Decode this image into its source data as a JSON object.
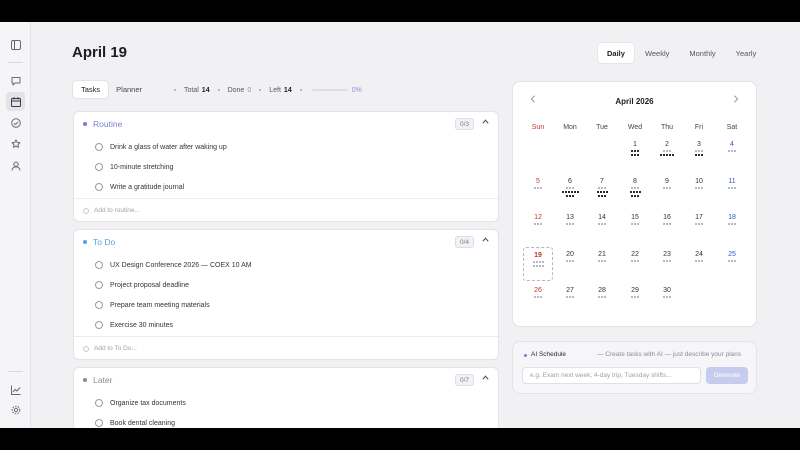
{
  "header": {
    "title": "April 19"
  },
  "view_options": [
    "Daily",
    "Weekly",
    "Monthly",
    "Yearly"
  ],
  "active_view": "Daily",
  "tabs": [
    "Tasks",
    "Planner"
  ],
  "active_tab": "Tasks",
  "stats": {
    "total_label": "Total",
    "total": "14",
    "done_label": "Done",
    "done": "0",
    "left_label": "Left",
    "left": "14",
    "progress_pct": "0%",
    "progress_fraction": 0
  },
  "sections": [
    {
      "title": "Routine",
      "count": "0/3",
      "color": "#7b7fd0",
      "tasks": [
        "Drink a glass of water after waking up",
        "10-minute stretching",
        "Write a gratitude journal"
      ],
      "add_placeholder": "Add to routine..."
    },
    {
      "title": "To Do",
      "count": "0/4",
      "color": "#5b9fdc",
      "tasks": [
        "UX Design Conference 2026 — COEX 10 AM",
        "Project proposal deadline",
        "Prepare team meeting materials",
        "Exercise 30 minutes"
      ],
      "add_placeholder": "Add to To Do..."
    },
    {
      "title": "Later",
      "count": "0/7",
      "color": "#8a8a96",
      "tasks": [
        "Organize tax documents",
        "Book dental cleaning"
      ]
    }
  ],
  "calendar": {
    "title": "April 2026",
    "prev_icon": "chevron-left-icon",
    "next_icon": "chevron-right-icon",
    "weekdays": [
      "Sun",
      "Mon",
      "Tue",
      "Wed",
      "Thu",
      "Fri",
      "Sat"
    ],
    "today": "19",
    "sunday_color": "#c0392b",
    "saturday_color": "#3a56c4",
    "weeks": [
      [
        null,
        null,
        null,
        "1",
        "2",
        "3",
        "4"
      ],
      [
        "5",
        "6",
        "7",
        "8",
        "9",
        "10",
        "11"
      ],
      [
        "12",
        "13",
        "14",
        "15",
        "16",
        "17",
        "18"
      ],
      [
        "19",
        "20",
        "21",
        "22",
        "23",
        "24",
        "25"
      ],
      [
        "26",
        "27",
        "28",
        "29",
        "30",
        null,
        null
      ]
    ]
  },
  "ai": {
    "label": "AI Schedule",
    "description": "— Create tasks with AI — just describe your plans",
    "placeholder": "e.g. Exam next week, 4-day trip, Tuesday shifts...",
    "button": "Generate"
  },
  "sidebar_icons": [
    "sidebar-toggle-icon",
    "chat-icon",
    "calendar-icon",
    "check-circle-icon",
    "star-icon",
    "user-icon",
    "chart-icon",
    "settings-icon"
  ]
}
